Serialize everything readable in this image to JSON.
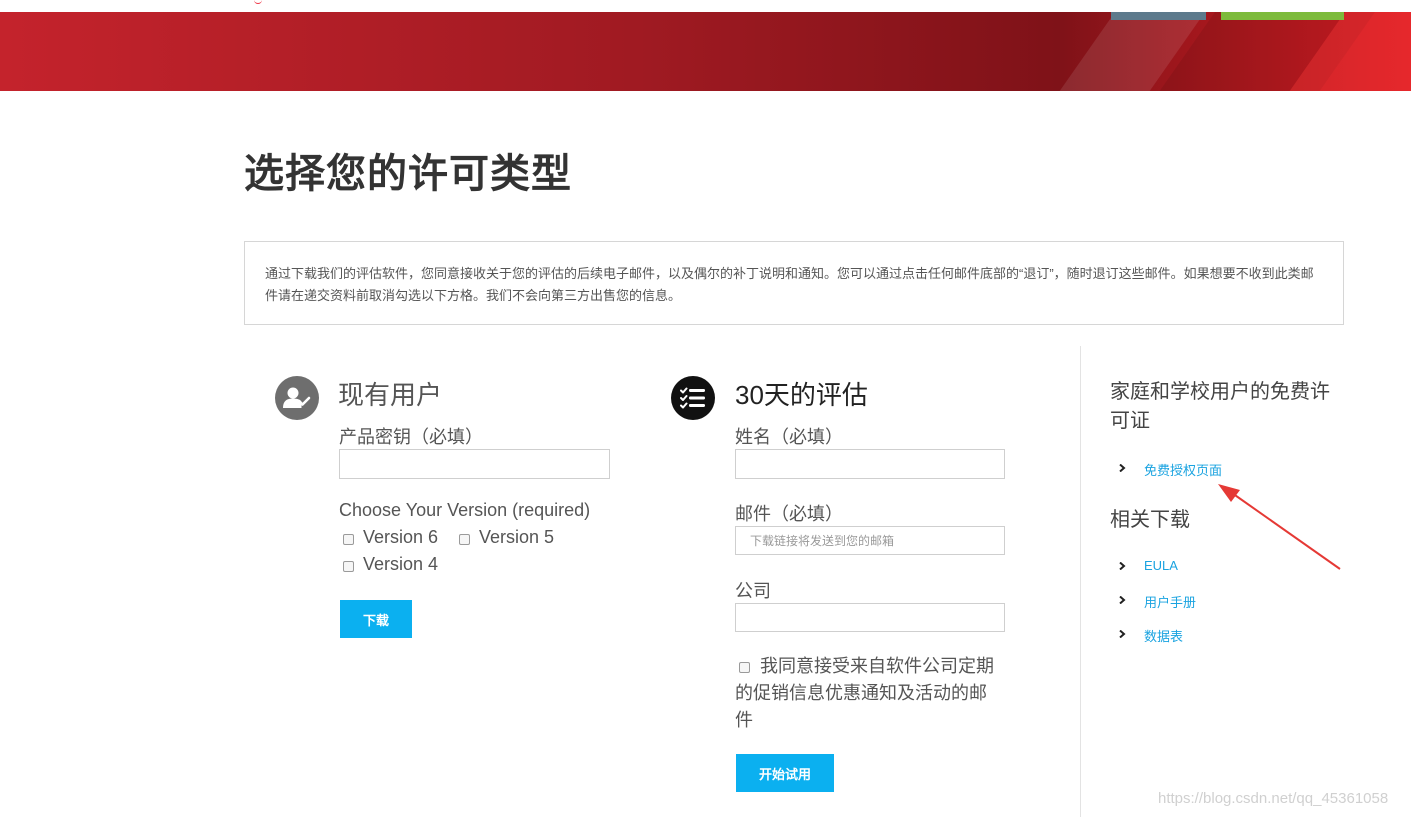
{
  "header": {
    "brand_color": "#b81f28"
  },
  "page": {
    "title": "选择您的许可类型"
  },
  "notice": {
    "text": "通过下载我们的评估软件，您同意接收关于您的评估的后续电子邮件，以及偶尔的补丁说明和通知。您可以通过点击任何邮件底部的“退订”，随时退订这些邮件。如果想要不收到此类邮件请在递交资料前取消勾选以下方格。我们不会向第三方出售您的信息。"
  },
  "existing_user": {
    "title": "现有用户",
    "icon": "user-check-icon",
    "product_key_label": "产品密钥（必填）",
    "product_key_value": "",
    "version_label": "Choose Your Version (required)",
    "versions": [
      "Version 6",
      "Version 5",
      "Version 4"
    ],
    "download_label": "下载"
  },
  "trial": {
    "title": "30天的评估",
    "icon": "checklist-icon",
    "name_label": "姓名（必填）",
    "email_label": "邮件（必填）",
    "email_placeholder": "下载链接将发送到您的邮箱",
    "company_label": "公司",
    "consent_label": "我同意接受来自软件公司定期的促销信息优惠通知及活动的邮件",
    "start_label": "开始试用"
  },
  "sidebar": {
    "free_title": "家庭和学校用户的免费许可证",
    "free_links": [
      "免费授权页面"
    ],
    "related_title": "相关下载",
    "related_links": [
      "EULA",
      "用户手册",
      "数据表"
    ],
    "link_color": "#1aa3e0"
  },
  "watermark": "https://blog.csdn.net/qq_45361058"
}
